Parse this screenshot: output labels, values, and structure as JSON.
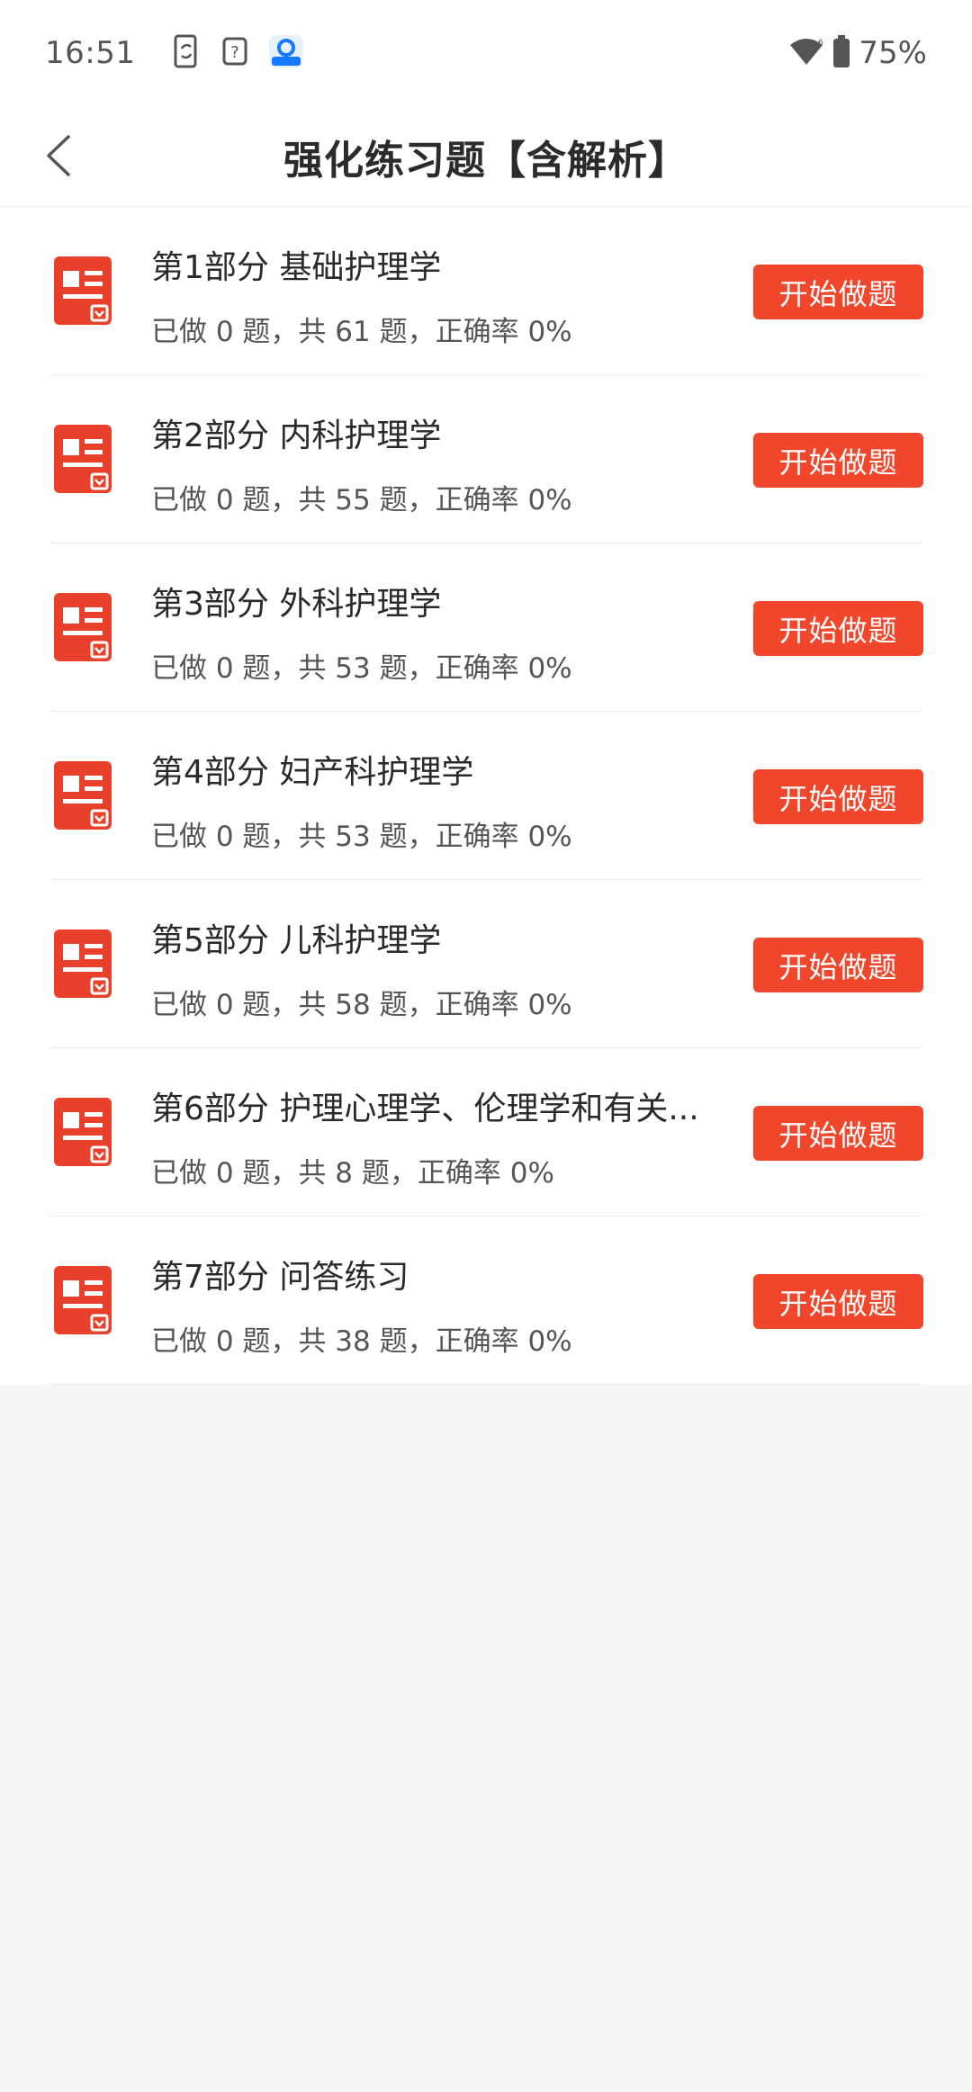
{
  "status_bar": {
    "time": "16:51",
    "battery": "75%",
    "icons": [
      "phone-sync-icon",
      "question-box-icon",
      "app-notification-icon",
      "wifi-icon",
      "battery-icon"
    ]
  },
  "header": {
    "title": "强化练习题【含解析】",
    "back_icon": "chevron-left-icon"
  },
  "colors": {
    "accent": "#f0462c",
    "icon_red": "#e8402a",
    "background": "#f5f5f5"
  },
  "sections": [
    {
      "title": "第1部分 基础护理学",
      "progress": "已做 0 题，共 61 题，正确率 0%",
      "button": "开始做题"
    },
    {
      "title": "第2部分 内科护理学",
      "progress": "已做 0 题，共 55 题，正确率 0%",
      "button": "开始做题"
    },
    {
      "title": "第3部分 外科护理学",
      "progress": "已做 0 题，共 53 题，正确率 0%",
      "button": "开始做题"
    },
    {
      "title": "第4部分 妇产科护理学",
      "progress": "已做 0 题，共 53 题，正确率 0%",
      "button": "开始做题"
    },
    {
      "title": "第5部分 儿科护理学",
      "progress": "已做 0 题，共 58 题，正确率 0%",
      "button": "开始做题"
    },
    {
      "title": "第6部分 护理心理学、伦理学和有关...",
      "progress": "已做 0 题，共 8 题，正确率 0%",
      "button": "开始做题"
    },
    {
      "title": "第7部分 问答练习",
      "progress": "已做 0 题，共 38 题，正确率 0%",
      "button": "开始做题"
    }
  ]
}
